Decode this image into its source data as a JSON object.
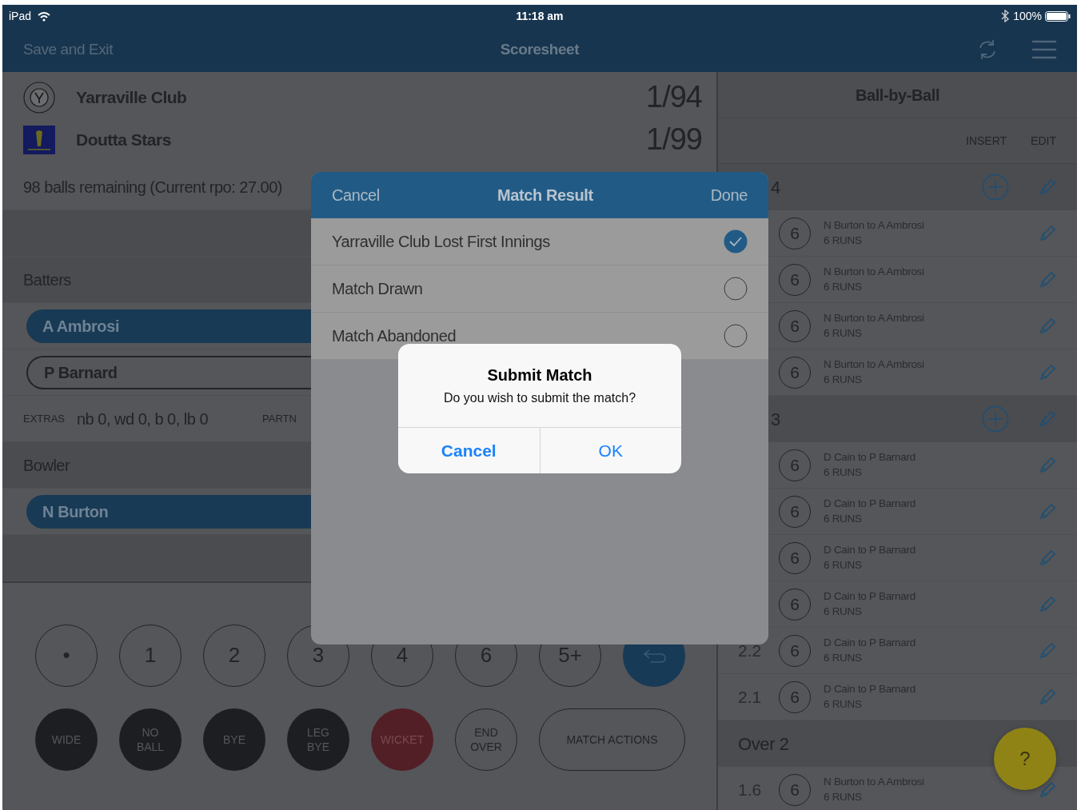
{
  "status_bar": {
    "device": "iPad",
    "time": "11:18 am",
    "battery": "100%"
  },
  "nav_bar": {
    "left": "Save and Exit",
    "title": "Scoresheet"
  },
  "teams": [
    {
      "name": "Yarraville Club",
      "score": "1/94"
    },
    {
      "name": "Doutta Stars",
      "score": "1/99"
    }
  ],
  "balls_remaining": "98 balls remaining (Current rpo: 27.00)",
  "batters": {
    "heading": "Batters",
    "players": [
      {
        "name": "A Ambrosi",
        "selected": true
      },
      {
        "name": "P Barnard",
        "selected": false
      }
    ]
  },
  "extras": {
    "label": "EXTRAS",
    "value": "nb 0, wd 0, b 0, lb 0",
    "partnership_label": "PARTN"
  },
  "bowler": {
    "heading": "Bowler",
    "players": [
      {
        "name": "N Burton",
        "selected": true
      }
    ]
  },
  "run_buttons": [
    {
      "label": "•",
      "kind": "outline"
    },
    {
      "label": "1",
      "kind": "outline"
    },
    {
      "label": "2",
      "kind": "outline"
    },
    {
      "label": "3",
      "kind": "outline"
    },
    {
      "label": "4",
      "kind": "outline"
    },
    {
      "label": "6",
      "kind": "outline"
    },
    {
      "label": "5+",
      "kind": "outline"
    },
    {
      "kind": "undo"
    }
  ],
  "extra_buttons": [
    {
      "label": "WIDE",
      "kind": "dark"
    },
    {
      "label": "NO BALL",
      "kind": "dark"
    },
    {
      "label": "BYE",
      "kind": "dark"
    },
    {
      "label": "LEG BYE",
      "kind": "dark"
    },
    {
      "label": "WICKET",
      "kind": "wicket"
    },
    {
      "label": "END OVER",
      "kind": "outline"
    },
    {
      "label": "MATCH ACTIONS",
      "kind": "wide"
    }
  ],
  "ball_by_ball": {
    "title": "Ball-by-Ball",
    "columns": [
      "INSERT",
      "EDIT"
    ],
    "overs": [
      {
        "label": "4",
        "balls": [
          {
            "runs": "6",
            "description": "N Burton to A Ambrosi",
            "result": "6 RUNS"
          },
          {
            "runs": "6",
            "description": "N Burton to A Ambrosi",
            "result": "6 RUNS"
          },
          {
            "runs": "6",
            "description": "N Burton to A Ambrosi",
            "result": "6 RUNS"
          },
          {
            "runs": "6",
            "description": "N Burton to A Ambrosi",
            "result": "6 RUNS"
          }
        ]
      },
      {
        "label": "3",
        "balls": [
          {
            "runs": "6",
            "description": "D Cain to P Barnard",
            "result": "6 RUNS"
          },
          {
            "runs": "6",
            "description": "D Cain to P Barnard",
            "result": "6 RUNS"
          },
          {
            "runs": "6",
            "description": "D Cain to P Barnard",
            "result": "6 RUNS"
          },
          {
            "runs": "6",
            "description": "D Cain to P Barnard",
            "result": "6 RUNS"
          },
          {
            "number": "2.2",
            "runs": "6",
            "description": "D Cain to P Barnard",
            "result": "6 RUNS"
          },
          {
            "number": "2.1",
            "runs": "6",
            "description": "D Cain to P Barnard",
            "result": "6 RUNS"
          }
        ]
      },
      {
        "label": "Over 2",
        "balls": [
          {
            "number": "1.6",
            "runs": "6",
            "description": "N Burton to A Ambrosi",
            "result": "6 RUNS"
          }
        ]
      }
    ]
  },
  "match_result": {
    "cancel": "Cancel",
    "title": "Match Result",
    "done": "Done",
    "options": [
      {
        "label": "Yarraville Club Lost First Innings",
        "selected": true
      },
      {
        "label": "Match Drawn",
        "selected": false
      },
      {
        "label": "Match Abandoned",
        "selected": false
      }
    ]
  },
  "alert": {
    "title": "Submit Match",
    "message": "Do you wish to submit the match?",
    "buttons": [
      {
        "label": "Cancel",
        "kind": "cancel"
      },
      {
        "label": "OK",
        "kind": "default"
      }
    ]
  },
  "help_button": {
    "label": "?"
  }
}
